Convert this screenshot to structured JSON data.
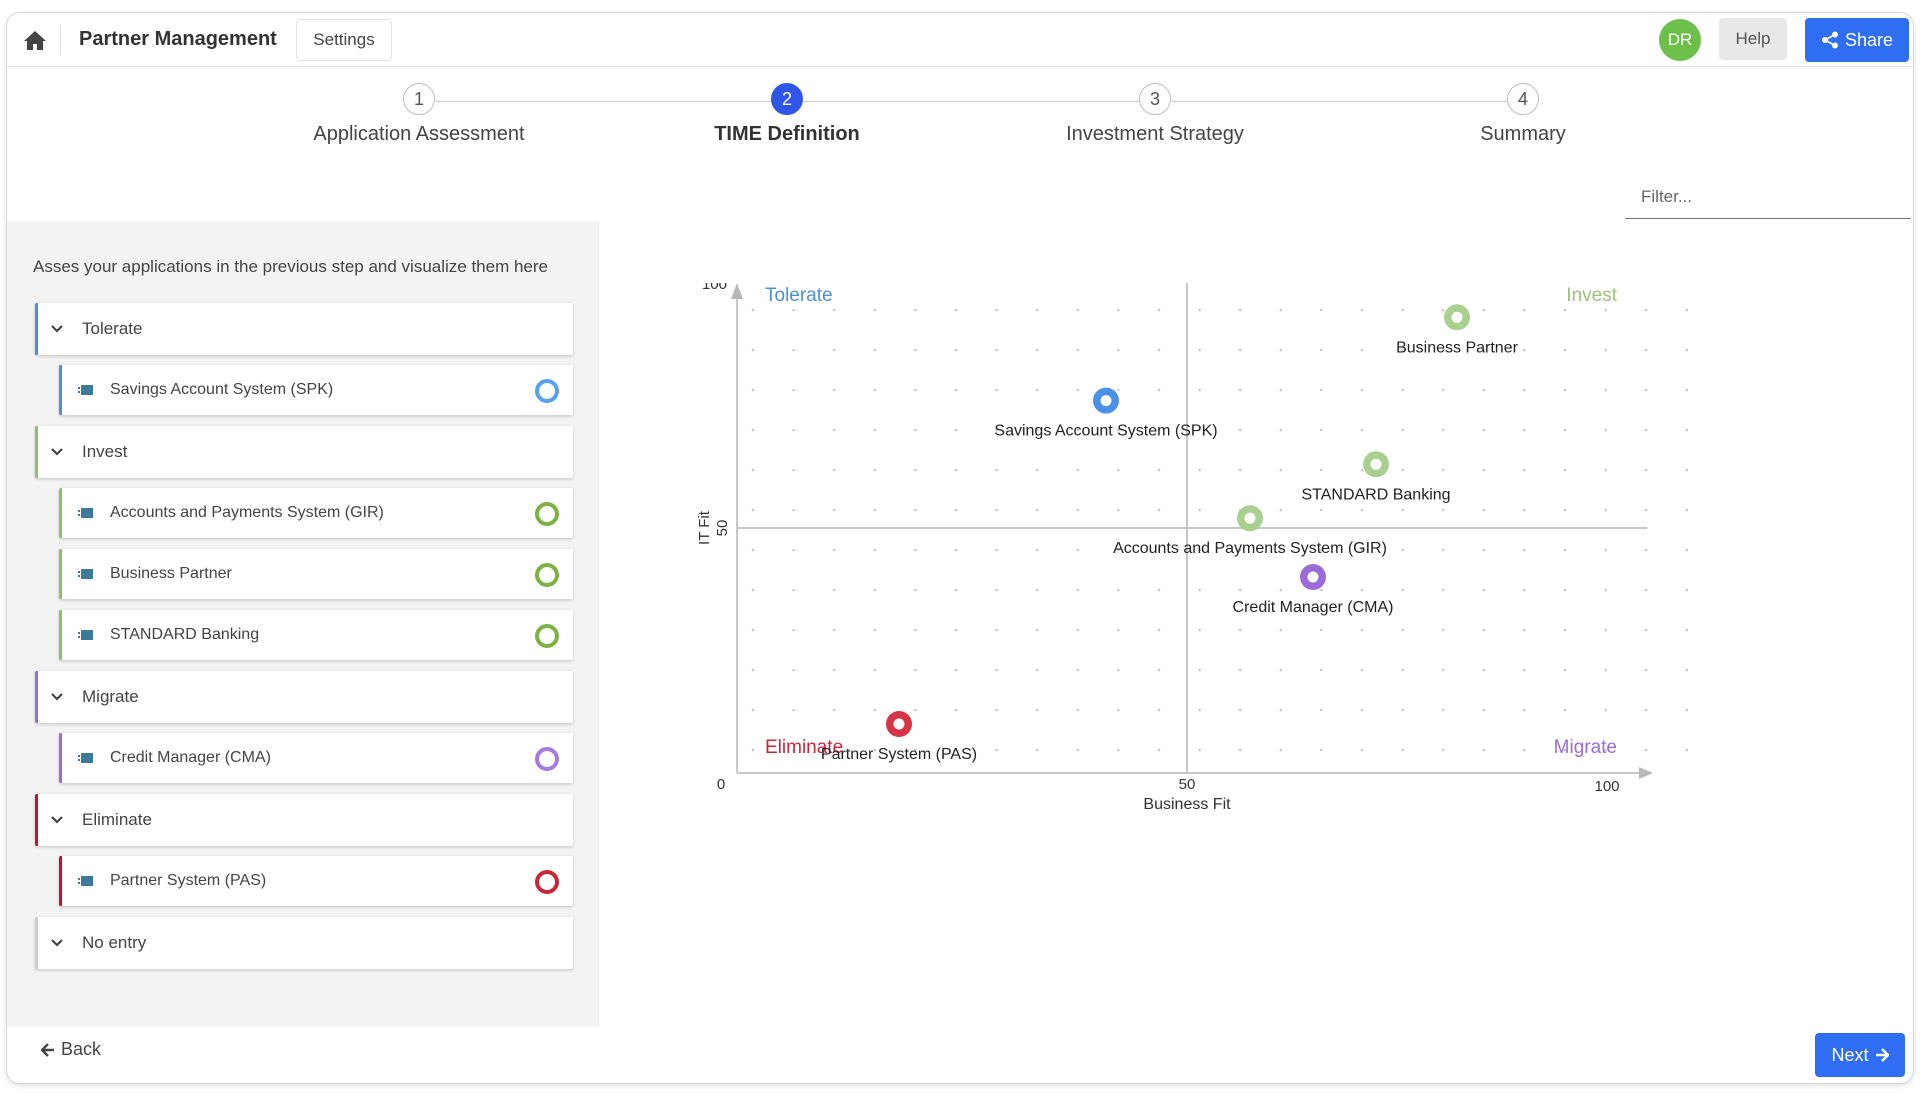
{
  "header": {
    "title": "Partner Management",
    "settings_label": "Settings",
    "avatar_initials": "DR",
    "help_label": "Help",
    "share_label": "Share"
  },
  "stepper": {
    "steps": [
      {
        "number": "1",
        "label": "Application Assessment",
        "active": false
      },
      {
        "number": "2",
        "label": "TIME Definition",
        "active": true
      },
      {
        "number": "3",
        "label": "Investment Strategy",
        "active": false
      },
      {
        "number": "4",
        "label": "Summary",
        "active": false
      }
    ]
  },
  "filter": {
    "placeholder": "Filter...",
    "value": ""
  },
  "panel": {
    "intro": "Asses your applications in the previous step and visualize them here",
    "groups": [
      {
        "name": "Tolerate",
        "color": "#4a90d9",
        "items": [
          {
            "name": "Savings Account System (SPK)",
            "ring": "#5aa0ee"
          }
        ]
      },
      {
        "name": "Invest",
        "color": "#8dc06a",
        "items": [
          {
            "name": "Accounts and Payments System (GIR)",
            "ring": "#7cb342"
          },
          {
            "name": "Business Partner",
            "ring": "#7cb342"
          },
          {
            "name": "STANDARD Banking",
            "ring": "#7cb342"
          }
        ]
      },
      {
        "name": "Migrate",
        "color": "#9b6cd8",
        "items": [
          {
            "name": "Credit Manager (CMA)",
            "ring": "#a57de0"
          }
        ]
      },
      {
        "name": "Eliminate",
        "color": "#c8102e",
        "items": [
          {
            "name": "Partner System (PAS)",
            "ring": "#c62838"
          }
        ]
      },
      {
        "name": "No entry",
        "color": "#cccccc",
        "items": []
      }
    ]
  },
  "chart_data": {
    "type": "scatter",
    "xlabel": "Business Fit",
    "ylabel": "IT Fit",
    "xlim": [
      0,
      100
    ],
    "ylim": [
      0,
      100
    ],
    "x_ticks": [
      "0",
      "50",
      "100"
    ],
    "y_ticks": [
      "0",
      "50",
      "100"
    ],
    "quadrants": {
      "top_left": {
        "label": "Tolerate",
        "color": "#4a90d9"
      },
      "top_right": {
        "label": "Invest",
        "color": "#9cc27a"
      },
      "bottom_left": {
        "label": "Eliminate",
        "color": "#c8283a"
      },
      "bottom_right": {
        "label": "Migrate",
        "color": "#9b6cd8"
      }
    },
    "points": [
      {
        "name": "Savings Account System (SPK)",
        "x": 41,
        "y": 76,
        "color": "#4a90e8"
      },
      {
        "name": "Business Partner",
        "x": 80,
        "y": 93,
        "color": "#a9d08e"
      },
      {
        "name": "STANDARD Banking",
        "x": 71,
        "y": 63,
        "color": "#a9d08e"
      },
      {
        "name": "Accounts and Payments System (GIR)",
        "x": 57,
        "y": 52,
        "color": "#a9d08e"
      },
      {
        "name": "Credit Manager (CMA)",
        "x": 64,
        "y": 40,
        "color": "#9b6cd8"
      },
      {
        "name": "Partner System (PAS)",
        "x": 18,
        "y": 10,
        "color": "#d63447"
      }
    ]
  },
  "footer": {
    "back_label": "Back",
    "next_label": "Next"
  }
}
